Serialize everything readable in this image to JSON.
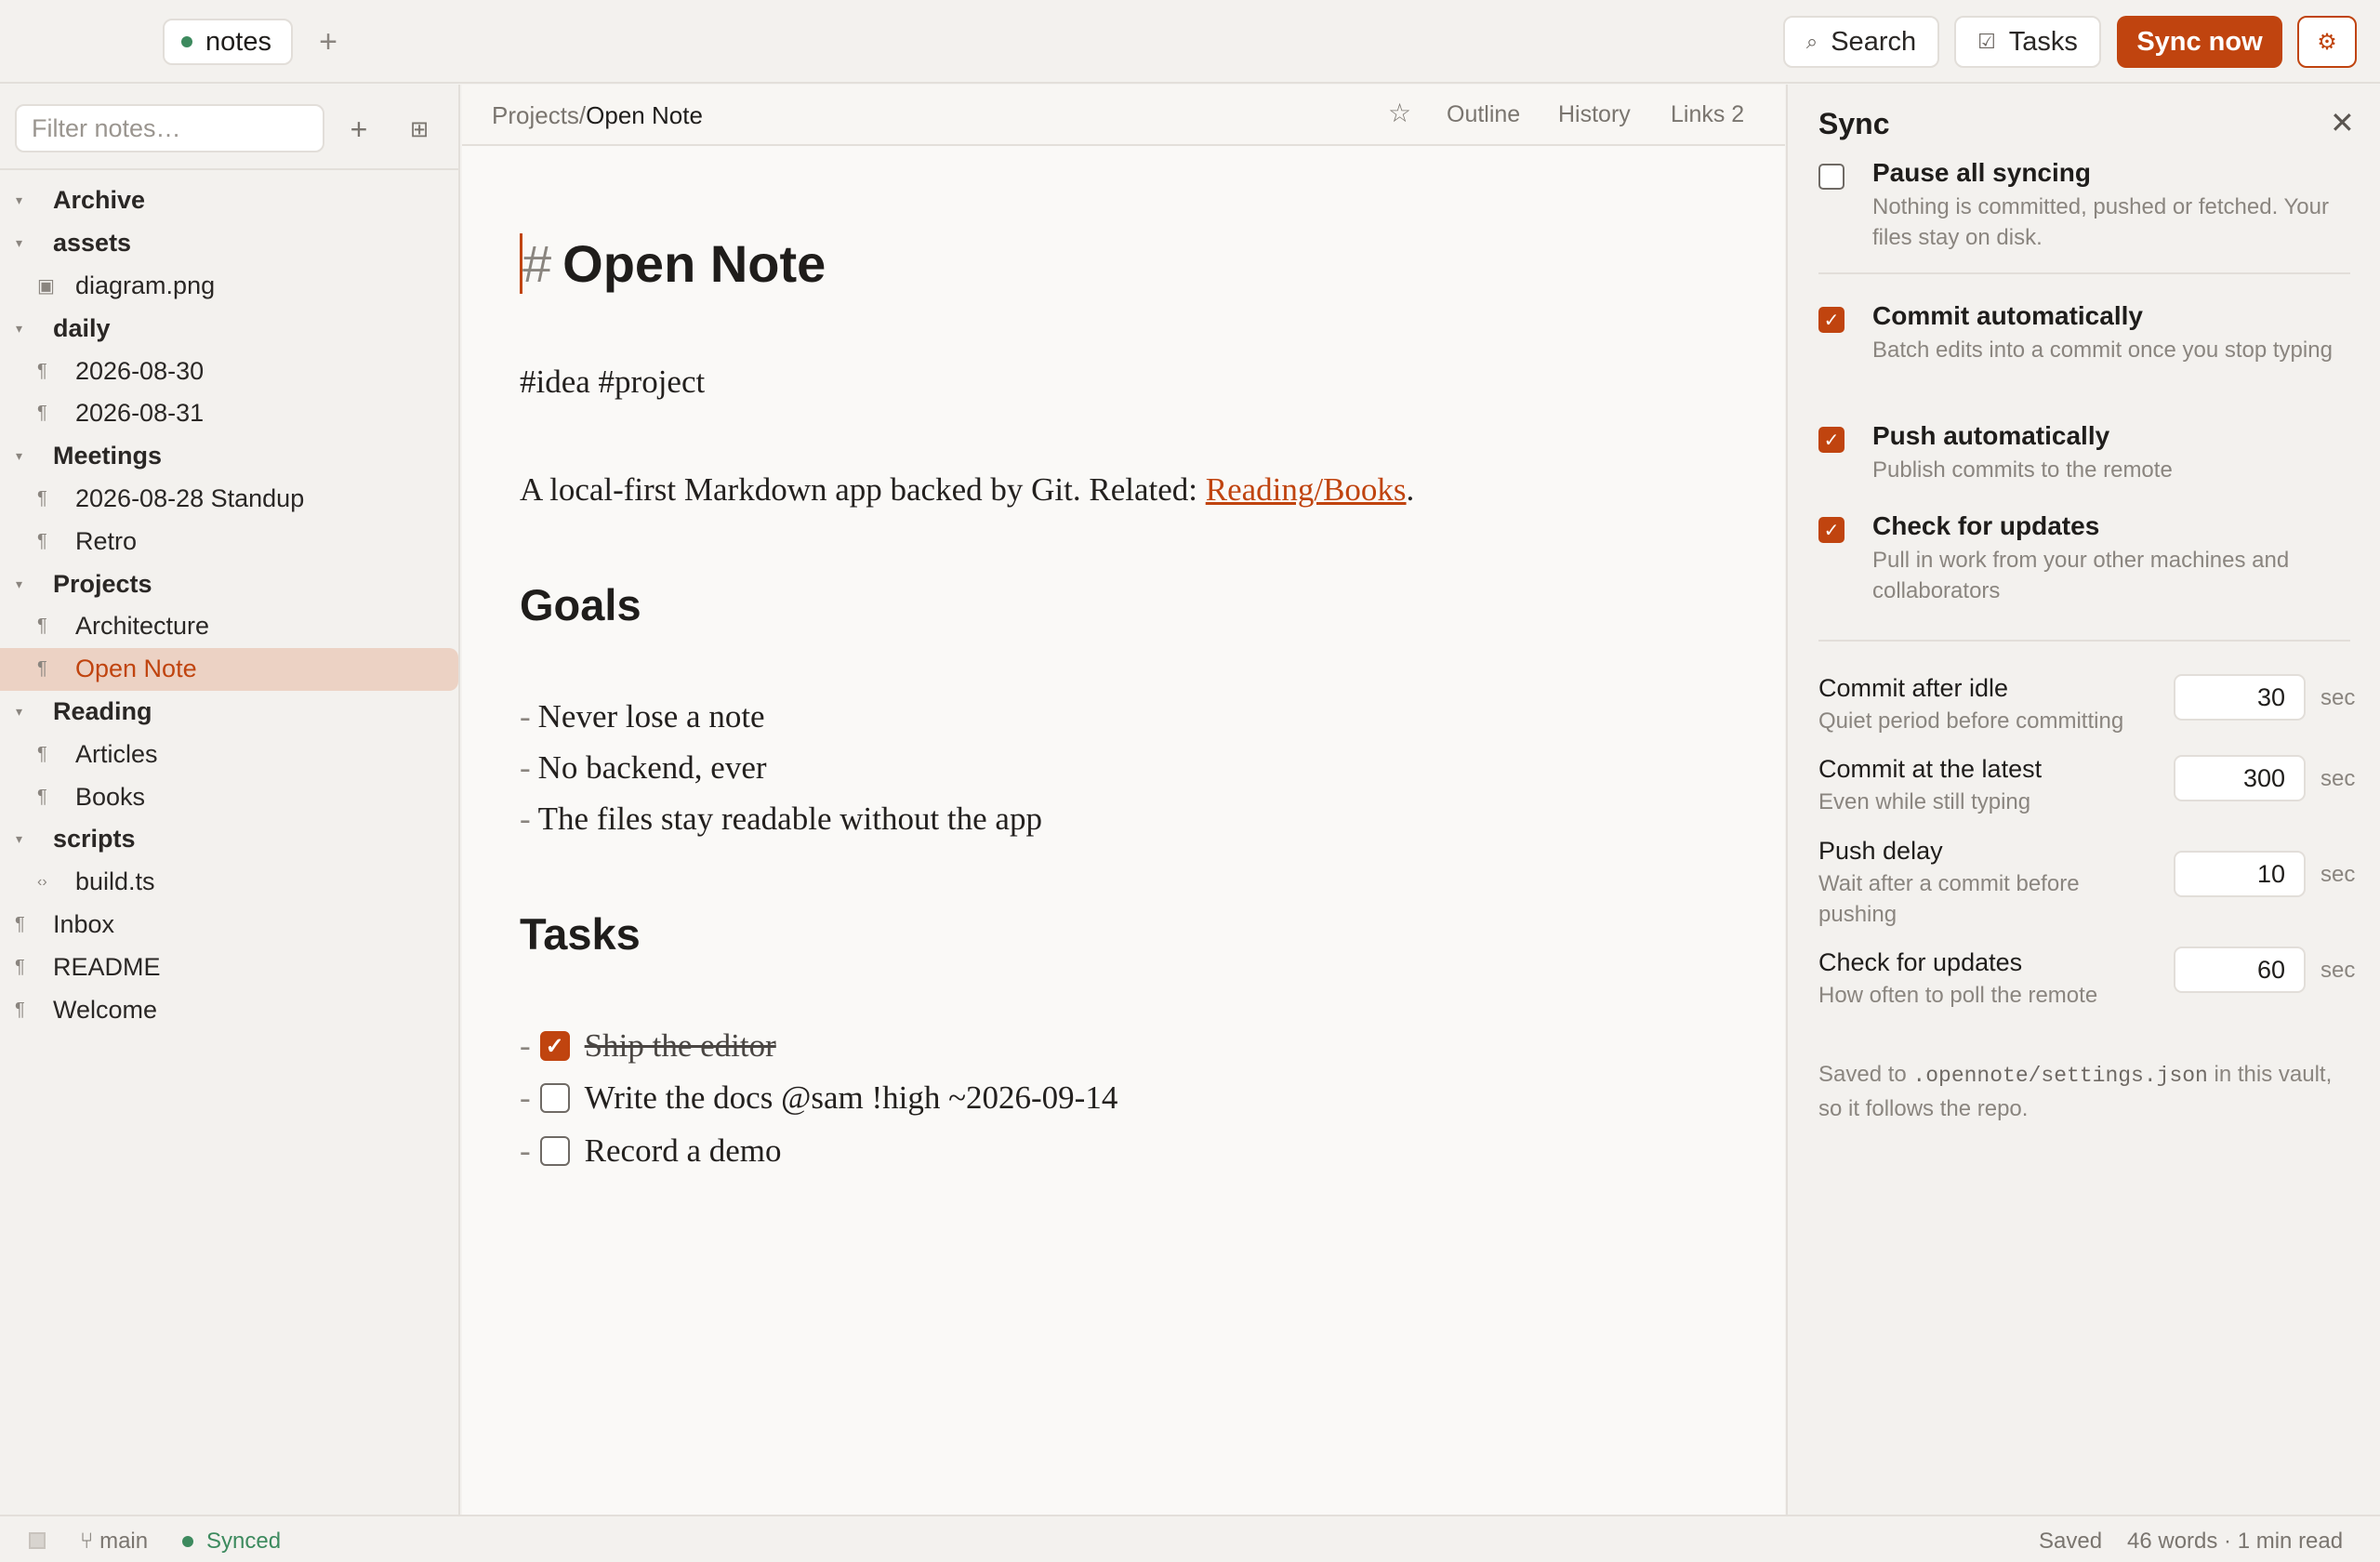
{
  "topbar": {
    "vault_name": "notes",
    "add_tab": "+",
    "search_label": "Search",
    "tasks_label": "Tasks",
    "sync_label": "Sync now",
    "settings_icon": "gear-icon"
  },
  "sidebar": {
    "filter_placeholder": "Filter notes…",
    "tree": [
      {
        "label": "Archive",
        "kind": "folder"
      },
      {
        "label": "assets",
        "kind": "folder"
      },
      {
        "label": "diagram.png",
        "kind": "image"
      },
      {
        "label": "daily",
        "kind": "folder"
      },
      {
        "label": "2026-08-30",
        "kind": "note"
      },
      {
        "label": "2026-08-31",
        "kind": "note"
      },
      {
        "label": "Meetings",
        "kind": "folder"
      },
      {
        "label": "2026-08-28 Standup",
        "kind": "note"
      },
      {
        "label": "Retro",
        "kind": "note"
      },
      {
        "label": "Projects",
        "kind": "folder"
      },
      {
        "label": "Architecture",
        "kind": "note"
      },
      {
        "label": "Open Note",
        "kind": "note",
        "active": true
      },
      {
        "label": "Reading",
        "kind": "folder"
      },
      {
        "label": "Articles",
        "kind": "note"
      },
      {
        "label": "Books",
        "kind": "note"
      },
      {
        "label": "scripts",
        "kind": "folder"
      },
      {
        "label": "build.ts",
        "kind": "code"
      },
      {
        "label": "Inbox",
        "kind": "root"
      },
      {
        "label": "README",
        "kind": "root"
      },
      {
        "label": "Welcome",
        "kind": "root"
      }
    ]
  },
  "editor": {
    "breadcrumb_path": "Projects/",
    "breadcrumb_current": "Open Note",
    "outline_label": "Outline",
    "history_label": "History",
    "links_label": "Links 2",
    "doc": {
      "h1_hash": "#",
      "h1": "Open Note",
      "tags": "#idea #project",
      "para_text": "A local-first Markdown app backed by Git. Related: ",
      "para_link": "Reading/Books",
      "para_end": ".",
      "goals_heading": "Goals",
      "goals": [
        "Never lose a note",
        "No backend, ever",
        "The files stay readable without the app"
      ],
      "tasks_heading": "Tasks",
      "tasks": [
        {
          "text": "Ship the editor",
          "done": true
        },
        {
          "text": "Write the docs @sam !high ~2026-09-14",
          "done": false
        },
        {
          "text": "Record a demo",
          "done": false
        }
      ]
    }
  },
  "sync_panel": {
    "title": "Sync",
    "options": [
      {
        "title": "Pause all syncing",
        "desc": "Nothing is committed, pushed or fetched. Your files stay on disk.",
        "checked": false
      },
      {
        "title": "Commit automatically",
        "desc": "Batch edits into a commit once you stop typing",
        "checked": true
      },
      {
        "title": "Push automatically",
        "desc": "Publish commits to the remote",
        "checked": true
      },
      {
        "title": "Check for updates",
        "desc": "Pull in work from your other machines and collaborators",
        "checked": true
      }
    ],
    "numbers": [
      {
        "title": "Commit after idle",
        "desc": "Quiet period before committing",
        "value": "30",
        "unit": "sec"
      },
      {
        "title": "Commit at the latest",
        "desc": "Even while still typing",
        "value": "300",
        "unit": "sec"
      },
      {
        "title": "Push delay",
        "desc": "Wait after a commit before pushing",
        "value": "10",
        "unit": "sec"
      },
      {
        "title": "Check for updates",
        "desc": "How often to poll the remote",
        "value": "60",
        "unit": "sec"
      }
    ],
    "note_pre": "Saved to ",
    "note_code": ".opennote/settings.json",
    "note_post": " in this vault, so it follows the repo."
  },
  "statusbar": {
    "branch": "main",
    "sync_status": "Synced",
    "saved": "Saved",
    "words": "46 words · 1 min read"
  },
  "colors": {
    "accent": "#c0440f",
    "synced_green": "#3d8a5e",
    "active_row": "#ecd2c4"
  }
}
